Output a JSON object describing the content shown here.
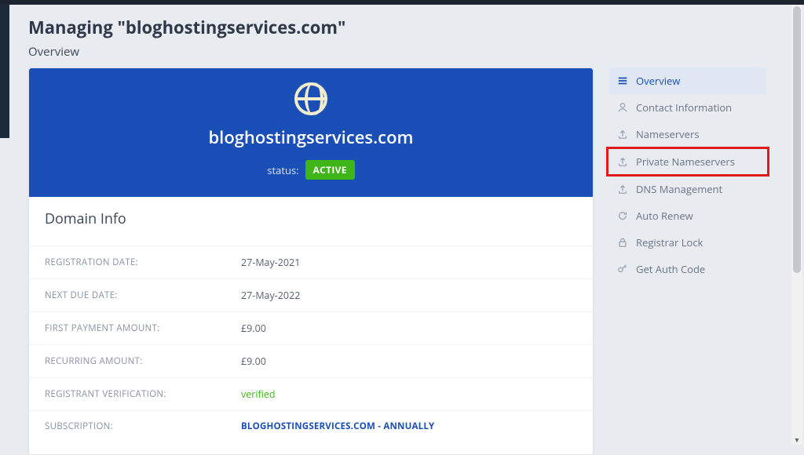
{
  "header": {
    "page_title": "Managing \"bloghostingservices.com\"",
    "subhead": "Overview"
  },
  "banner": {
    "domain": "bloghostingservices.com",
    "status_label": "status:",
    "status_value": "ACTIVE"
  },
  "section": {
    "title": "Domain Info"
  },
  "info": [
    {
      "label": "REGISTRATION DATE:",
      "value": "27-May-2021",
      "kind": "text"
    },
    {
      "label": "NEXT DUE DATE:",
      "value": "27-May-2022",
      "kind": "text"
    },
    {
      "label": "FIRST PAYMENT AMOUNT:",
      "value": "£9.00",
      "kind": "text"
    },
    {
      "label": "RECURRING AMOUNT:",
      "value": "£9.00",
      "kind": "text"
    },
    {
      "label": "REGISTRANT VERIFICATION:",
      "value": "verified",
      "kind": "verified"
    },
    {
      "label": "SUBSCRIPTION:",
      "value": "BLOGHOSTINGSERVICES.COM - ANNUALLY",
      "kind": "link"
    }
  ],
  "sidebar": {
    "items": [
      {
        "label": "Overview",
        "icon": "list",
        "active": true
      },
      {
        "label": "Contact Information",
        "icon": "user"
      },
      {
        "label": "Nameservers",
        "icon": "upload"
      },
      {
        "label": "Private Nameservers",
        "icon": "upload",
        "highlight": true
      },
      {
        "label": "DNS Management",
        "icon": "upload"
      },
      {
        "label": "Auto Renew",
        "icon": "refresh"
      },
      {
        "label": "Registrar Lock",
        "icon": "lock"
      },
      {
        "label": "Get Auth Code",
        "icon": "key"
      }
    ]
  }
}
